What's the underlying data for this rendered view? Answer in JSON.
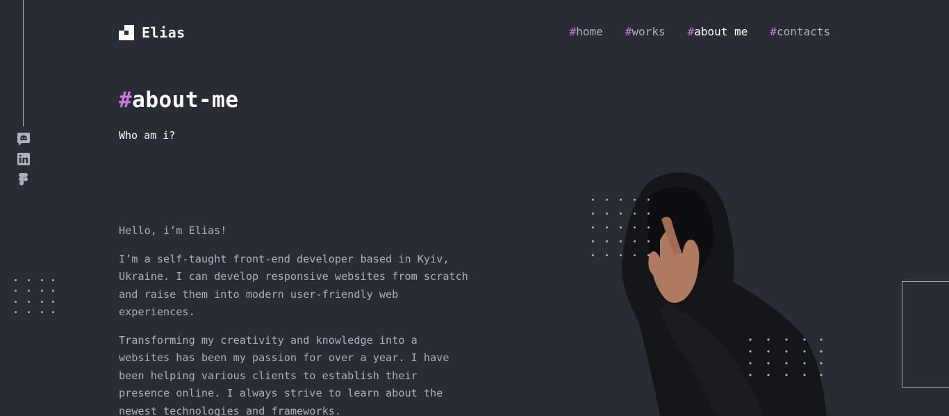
{
  "header": {
    "logo_text": "Elias",
    "nav": [
      {
        "hash": "#",
        "label": "home",
        "active": false
      },
      {
        "hash": "#",
        "label": "works",
        "active": false
      },
      {
        "hash": "#",
        "label": "about me",
        "active": true
      },
      {
        "hash": "#",
        "label": "contacts",
        "active": false
      }
    ]
  },
  "social": {
    "icons": [
      "discord-icon",
      "linkedin-icon",
      "figma-icon"
    ]
  },
  "main": {
    "title_hash": "#",
    "title": "about-me",
    "subtitle": "Who am i?",
    "paragraphs": [
      "Hello, i’m Elias!",
      "I’m a self-taught front-end developer based in Kyiv, Ukraine. I can develop responsive websites from scratch and raise them into modern user-friendly web experiences.",
      "Transforming my creativity and knowledge into a websites has been my passion for over a year. I have been helping various clients to establish their presence online. I always strive to learn about the newest technologies and frameworks."
    ]
  },
  "colors": {
    "background": "#282c33",
    "accent": "#c778dd",
    "text": "#abb2bf",
    "heading": "#ffffff"
  }
}
